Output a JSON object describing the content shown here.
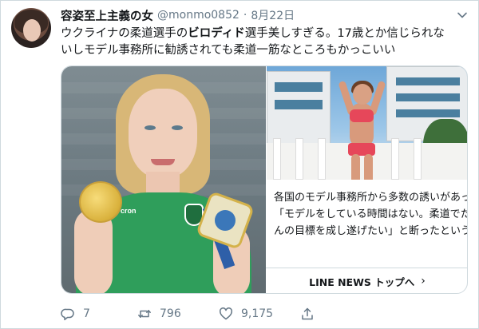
{
  "tweet": {
    "author": {
      "display_name": "容姿至上主義の女",
      "handle": "@monmo0852",
      "separator": "·",
      "date": "8月22日"
    },
    "text": {
      "line1_before": "ウクライナの柔道選手の",
      "line1_bold": "ビロディド",
      "line1_after": "選手美しすぎる。17歳とか信じられな",
      "line2": "いしモデル事務所に勧誘されても柔道一筋なところもかっこいい"
    },
    "card": {
      "lines": [
        "各国のモデル事務所から多数の誘いがあった",
        "「モデルをしている時間はない。柔道でたく",
        "んの目標を成し遂げたい」と断ったという。"
      ],
      "link_label": "LINE NEWS トップへ",
      "link_chevron": "›",
      "shirt_text": "cron"
    },
    "actions": {
      "reply_count": "7",
      "retweet_count": "796",
      "like_count": "9,175"
    }
  },
  "icons": {
    "menu": "chevron-down-icon",
    "reply": "reply-icon",
    "retweet": "retweet-icon",
    "like": "heart-icon",
    "share": "share-icon"
  },
  "colors": {
    "text": "#14171a",
    "muted": "#657786",
    "border": "#cfd9de"
  }
}
